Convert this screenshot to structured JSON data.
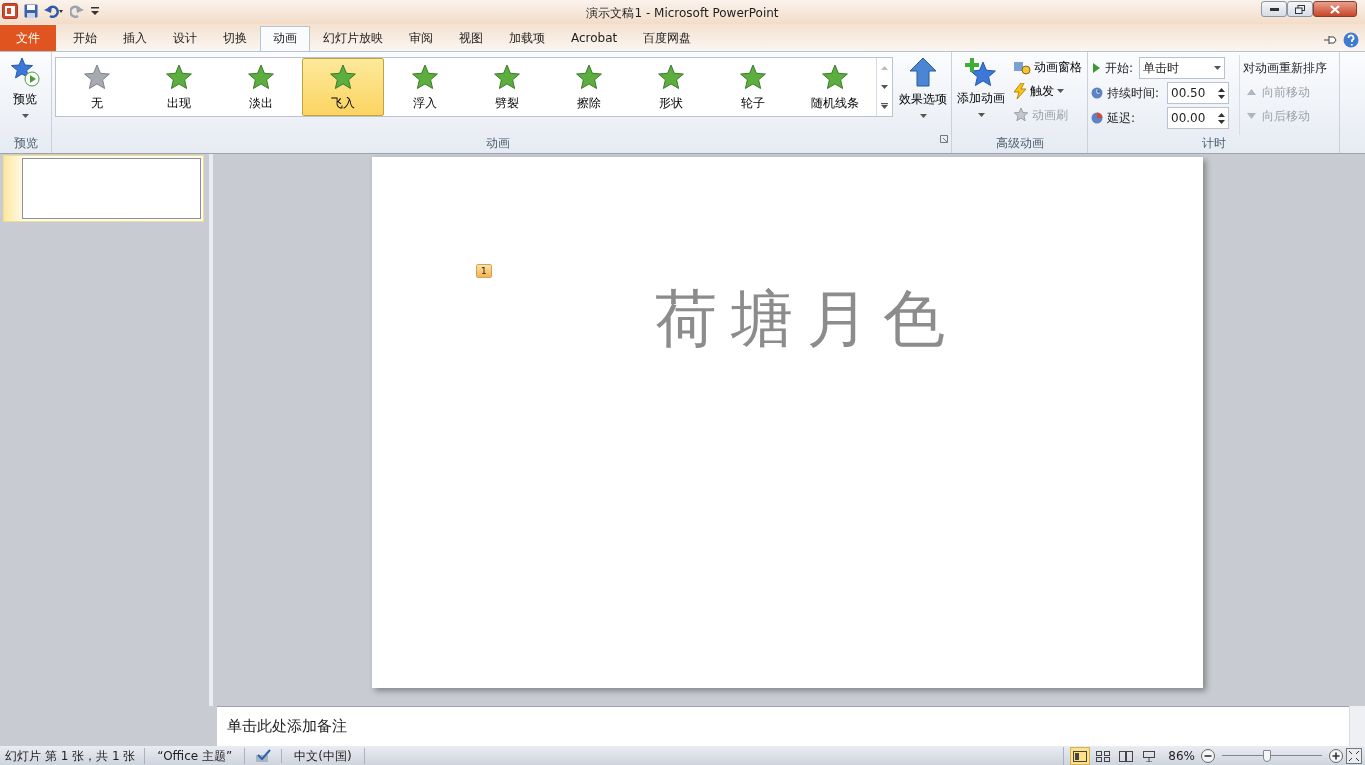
{
  "window": {
    "title": "演示文稿1  -  Microsoft PowerPoint"
  },
  "tabs": [
    {
      "label": "文件",
      "kind": "file",
      "selected": false
    },
    {
      "label": "开始",
      "kind": "tab",
      "selected": false
    },
    {
      "label": "插入",
      "kind": "tab",
      "selected": false
    },
    {
      "label": "设计",
      "kind": "tab",
      "selected": false
    },
    {
      "label": "切换",
      "kind": "tab",
      "selected": false
    },
    {
      "label": "动画",
      "kind": "tab",
      "selected": true
    },
    {
      "label": "幻灯片放映",
      "kind": "tab",
      "selected": false
    },
    {
      "label": "审阅",
      "kind": "tab",
      "selected": false
    },
    {
      "label": "视图",
      "kind": "tab",
      "selected": false
    },
    {
      "label": "加载项",
      "kind": "tab",
      "selected": false
    },
    {
      "label": "Acrobat",
      "kind": "tab",
      "selected": false
    },
    {
      "label": "百度网盘",
      "kind": "tab",
      "selected": false
    }
  ],
  "ribbon": {
    "preview": {
      "button": "预览",
      "label": "预览"
    },
    "animation": {
      "label": "动画",
      "items": [
        {
          "label": "无",
          "selected": false
        },
        {
          "label": "出现",
          "selected": false
        },
        {
          "label": "淡出",
          "selected": false
        },
        {
          "label": "飞入",
          "selected": true
        },
        {
          "label": "浮入",
          "selected": false
        },
        {
          "label": "劈裂",
          "selected": false
        },
        {
          "label": "擦除",
          "selected": false
        },
        {
          "label": "形状",
          "selected": false
        },
        {
          "label": "轮子",
          "selected": false
        },
        {
          "label": "随机线条",
          "selected": false
        }
      ],
      "effect_options": "效果选项"
    },
    "advanced": {
      "label": "高级动画",
      "add": "添加动画",
      "pane": "动画窗格",
      "trigger": "触发",
      "painter": {
        "label": "动画刷",
        "disabled": true
      }
    },
    "timing": {
      "label": "计时",
      "start_label": "开始:",
      "start_value": "单击时",
      "duration_label": "持续时间:",
      "duration_value": "00.50",
      "delay_label": "延迟:",
      "delay_value": "00.00",
      "reorder_title": "对动画重新排序",
      "move_earlier": {
        "label": "向前移动",
        "disabled": true
      },
      "move_later": {
        "label": "向后移动",
        "disabled": true
      }
    }
  },
  "slide": {
    "title": "荷塘月色",
    "animation_badge": "1"
  },
  "notes": {
    "placeholder": "单击此处添加备注"
  },
  "status_bar": {
    "slide_info": "幻灯片 第 1 张，共 1 张",
    "theme": "“Office 主题”",
    "language": "中文(中国)",
    "views": [
      {
        "selected": true
      },
      {
        "selected": false
      },
      {
        "selected": false
      },
      {
        "selected": false
      }
    ],
    "zoom": "86%",
    "zoom_slider": {
      "level": 0.45
    }
  }
}
